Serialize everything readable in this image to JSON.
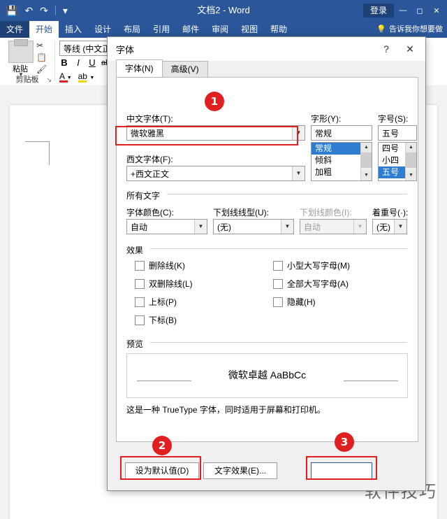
{
  "window": {
    "title": "文档2 - Word",
    "signin_label": "登录",
    "quick_access": [
      "save-icon",
      "undo-icon",
      "redo-icon",
      "customize-qat-icon"
    ],
    "controls": [
      "minimize-icon",
      "restore-icon",
      "close-icon"
    ],
    "tellme": "告诉我你想要做"
  },
  "ribbon": {
    "tabs": [
      "文件",
      "开始",
      "插入",
      "设计",
      "布局",
      "引用",
      "邮件",
      "审阅",
      "视图",
      "帮助"
    ],
    "active_tab": "开始",
    "clipboard": {
      "paste_label": "粘贴",
      "group_label": "剪贴板",
      "launcher": "↘"
    },
    "font": {
      "font_name": "等线 (中文正",
      "font_size": "",
      "bold": "B",
      "italic": "I",
      "underline": "U",
      "strikethrough": "abc",
      "text_color": "A",
      "highlight": "ab"
    }
  },
  "dialog": {
    "title": "字体",
    "help_icon": "?",
    "close_icon": "✕",
    "tabs": [
      {
        "label": "字体(N)",
        "active": true
      },
      {
        "label": "高级(V)",
        "active": false
      }
    ],
    "cn_font": {
      "label": "中文字体(T):",
      "value": "微软雅黑"
    },
    "style": {
      "label": "字形(Y):",
      "value": "常规",
      "options": [
        "常规",
        "倾斜",
        "加粗"
      ],
      "selected": "常规"
    },
    "size": {
      "label": "字号(S):",
      "value": "五号",
      "options": [
        "四号",
        "小四",
        "五号"
      ],
      "selected": "五号"
    },
    "latin_font": {
      "label": "西文字体(F):",
      "value": "+西文正文"
    },
    "all_text": {
      "section": "所有文字",
      "color": {
        "label": "字体颜色(C):",
        "value": "自动"
      },
      "underline_style": {
        "label": "下划线线型(U):",
        "value": "(无)"
      },
      "underline_color": {
        "label": "下划线颜色(I):",
        "value": "自动",
        "disabled": true
      },
      "emphasis": {
        "label": "着重号(·):",
        "value": "(无)"
      }
    },
    "effects": {
      "section": "效果",
      "left": [
        {
          "label": "删除线(K)",
          "checked": false
        },
        {
          "label": "双删除线(L)",
          "checked": false
        },
        {
          "label": "上标(P)",
          "checked": false
        },
        {
          "label": "下标(B)",
          "checked": false
        }
      ],
      "right": [
        {
          "label": "小型大写字母(M)",
          "checked": false
        },
        {
          "label": "全部大写字母(A)",
          "checked": false
        },
        {
          "label": "隐藏(H)",
          "checked": false
        }
      ]
    },
    "preview": {
      "section": "预览",
      "sample": "微软卓越  AaBbCc",
      "description": "这是一种 TrueType 字体，同时适用于屏幕和打印机。"
    },
    "buttons": {
      "set_default": "设为默认值(D)",
      "text_effects": "文字效果(E)...",
      "ok": ""
    }
  },
  "annotations": {
    "markers": [
      "1",
      "2",
      "3"
    ],
    "accent_color": "#e02020"
  },
  "watermark": "软件技巧"
}
